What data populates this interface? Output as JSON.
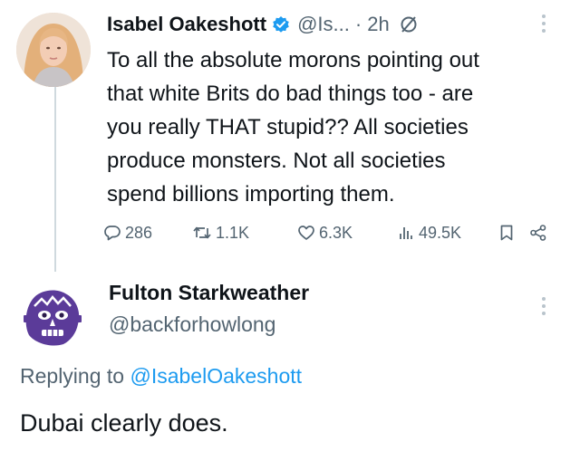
{
  "original_tweet": {
    "author_name": "Isabel Oakeshott",
    "handle": "@Is...",
    "separator": "·",
    "time": "2h",
    "text": "To all the absolute morons pointing out\nthat white Brits do bad things too - are\nyou really THAT stupid?? All societies\nproduce monsters. Not all societies\nspend billions importing them.",
    "stats": {
      "replies": "286",
      "reposts": "1.1K",
      "likes": "6.3K",
      "views": "49.5K"
    },
    "icons": [
      "verified-badge-icon",
      "no-edit-icon",
      "more-icon",
      "reply-icon",
      "repost-icon",
      "like-icon",
      "views-icon",
      "bookmark-icon",
      "share-icon"
    ]
  },
  "reply_tweet": {
    "author_name": "Fulton Starkweather",
    "handle": "@backforhowlong",
    "replying_prefix": "Replying to",
    "replying_to": "@IsabelOakeshott",
    "text": "Dubai clearly does."
  },
  "colors": {
    "text_primary": "#0f1419",
    "text_secondary": "#536471",
    "link_blue": "#1d9bf0",
    "verified_blue": "#1d9bf0",
    "thread_line": "#cfd9de",
    "reply_avatar_purple": "#5b3b99"
  }
}
